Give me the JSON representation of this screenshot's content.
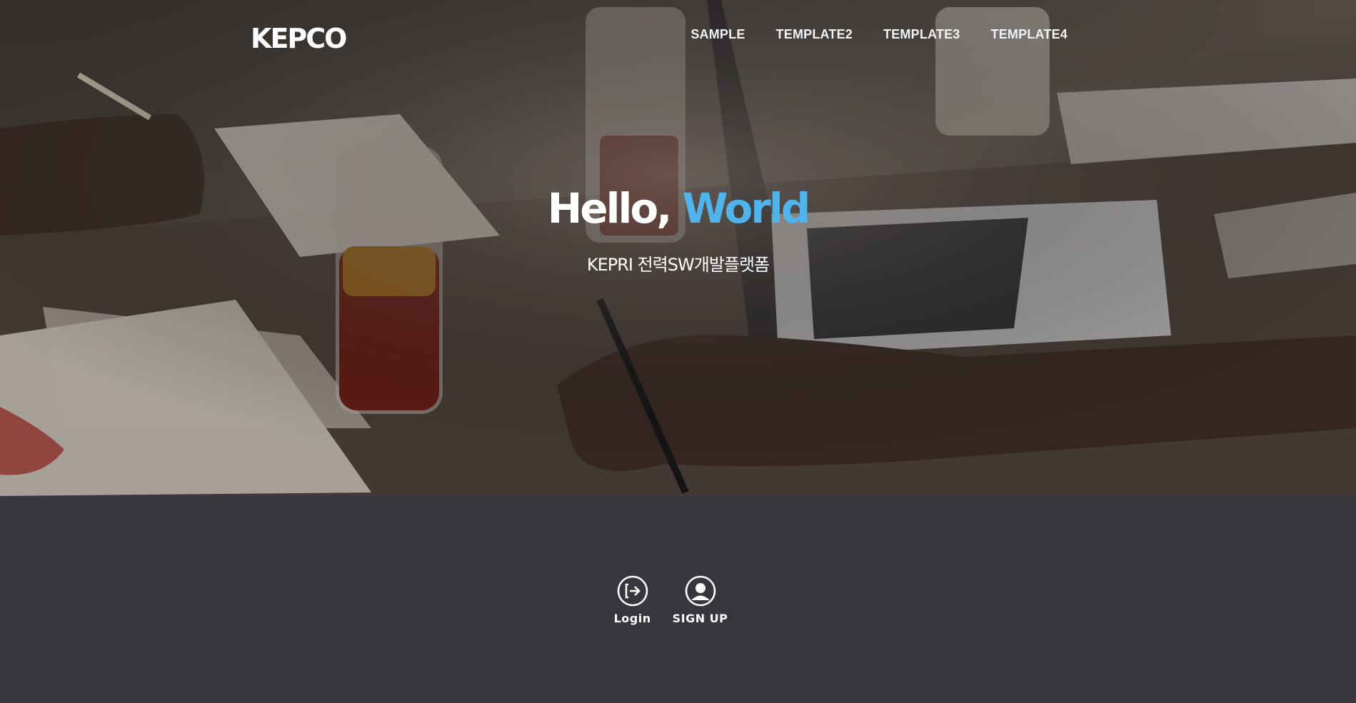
{
  "brand": {
    "logo_text": "KEPCO",
    "logo_icon": "kepco-logo"
  },
  "nav": {
    "items": [
      {
        "label": "SAMPLE"
      },
      {
        "label": "TEMPLATE2"
      },
      {
        "label": "TEMPLATE3"
      },
      {
        "label": "TEMPLATE4"
      }
    ]
  },
  "hero": {
    "title_prefix": "Hello, ",
    "title_accent": "World",
    "subtitle": "KEPRI 전력SW개발플랫폼",
    "background_image": "people working at desk with laptop and drinks"
  },
  "actions": {
    "login": {
      "label": "Login",
      "icon": "login-icon"
    },
    "signup": {
      "label": "SIGN UP",
      "icon": "user-icon"
    }
  },
  "colors": {
    "accent": "#4fb3ec",
    "footer_bg": "#38363d",
    "text": "#ffffff"
  }
}
